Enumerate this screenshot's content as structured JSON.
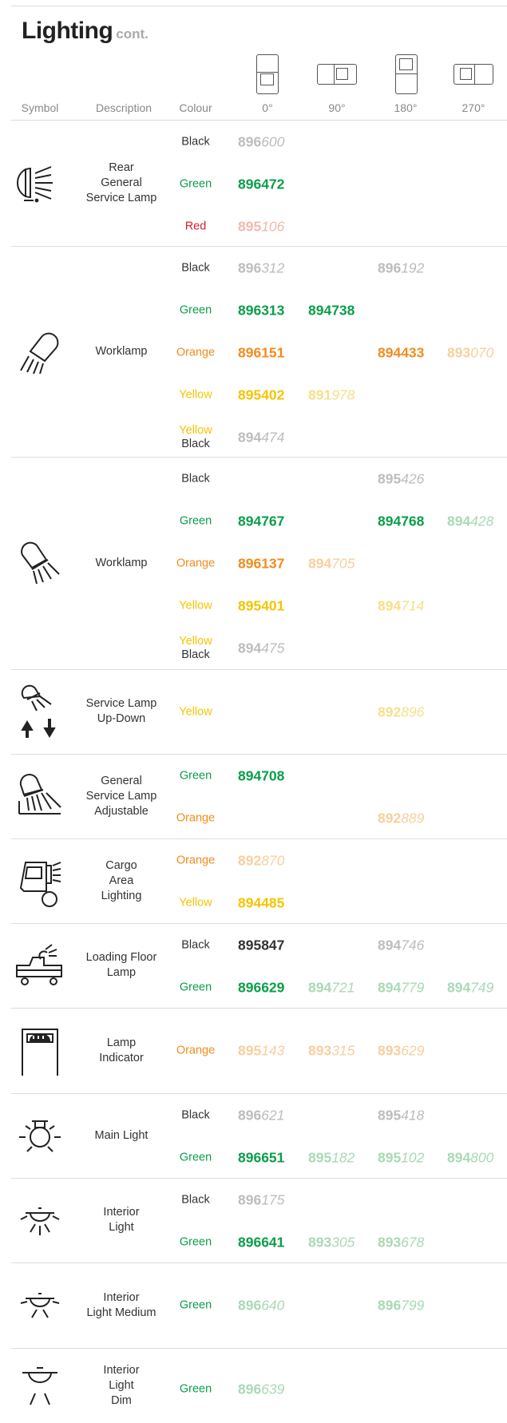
{
  "page": {
    "title": "Lighting",
    "title_suffix": "cont."
  },
  "colors": {
    "Black": "#333333",
    "Green": "#0a9e4a",
    "Red": "#d81e2c",
    "Orange": "#f28c1e",
    "Yellow": "#f5c400",
    "Black_faded": "#bdbdbd",
    "Green_faded": "#a9d9b6",
    "Red_faded": "#f2b9ae",
    "Orange_faded": "#f8cf9e",
    "Yellow_faded": "#f8df8a"
  },
  "headers": {
    "symbol": "Symbol",
    "description": "Description",
    "colour": "Colour",
    "orientations": [
      "0°",
      "90°",
      "180°",
      "270°"
    ]
  },
  "sections": [
    {
      "icon": "rear-general-service-lamp-icon",
      "description": "Rear General Service Lamp",
      "rows": [
        {
          "colour": "Black",
          "parts": [
            {
              "col": 0,
              "prefix": "896",
              "suffix": "600",
              "faded": true
            }
          ]
        },
        {
          "colour": "Green",
          "parts": [
            {
              "col": 0,
              "prefix": "896",
              "suffix": "472",
              "faded": false
            }
          ]
        },
        {
          "colour": "Red",
          "parts": [
            {
              "col": 0,
              "prefix": "895",
              "suffix": "106",
              "faded": true
            }
          ]
        }
      ]
    },
    {
      "icon": "worklamp-icon",
      "description": "Worklamp",
      "rows": [
        {
          "colour": "Black",
          "parts": [
            {
              "col": 0,
              "prefix": "896",
              "suffix": "312",
              "faded": true
            },
            {
              "col": 2,
              "prefix": "896",
              "suffix": "192",
              "faded": true
            }
          ]
        },
        {
          "colour": "Green",
          "parts": [
            {
              "col": 0,
              "prefix": "896",
              "suffix": "313",
              "faded": false
            },
            {
              "col": 1,
              "prefix": "894",
              "suffix": "738",
              "faded": false
            }
          ]
        },
        {
          "colour": "Orange",
          "parts": [
            {
              "col": 0,
              "prefix": "896",
              "suffix": "151",
              "faded": false
            },
            {
              "col": 2,
              "prefix": "894",
              "suffix": "433",
              "faded": false
            },
            {
              "col": 3,
              "prefix": "893",
              "suffix": "070",
              "faded": true
            }
          ]
        },
        {
          "colour": "Yellow",
          "parts": [
            {
              "col": 0,
              "prefix": "895",
              "suffix": "402",
              "faded": false
            },
            {
              "col": 1,
              "prefix": "891",
              "suffix": "978",
              "faded": true
            }
          ]
        },
        {
          "colour": "Yellow Black",
          "parts": [
            {
              "col": 0,
              "prefix": "894",
              "suffix": "474",
              "faded": true
            }
          ]
        }
      ]
    },
    {
      "icon": "worklamp-icon",
      "description": "Worklamp",
      "rows": [
        {
          "colour": "Black",
          "parts": [
            {
              "col": 2,
              "prefix": "895",
              "suffix": "426",
              "faded": true
            }
          ]
        },
        {
          "colour": "Green",
          "parts": [
            {
              "col": 0,
              "prefix": "894",
              "suffix": "767",
              "faded": false
            },
            {
              "col": 2,
              "prefix": "894",
              "suffix": "768",
              "faded": false
            },
            {
              "col": 3,
              "prefix": "894",
              "suffix": "428",
              "faded": true
            }
          ]
        },
        {
          "colour": "Orange",
          "parts": [
            {
              "col": 0,
              "prefix": "896",
              "suffix": "137",
              "faded": false
            },
            {
              "col": 1,
              "prefix": "894",
              "suffix": "705",
              "faded": true
            }
          ]
        },
        {
          "colour": "Yellow",
          "parts": [
            {
              "col": 0,
              "prefix": "895",
              "suffix": "401",
              "faded": false
            },
            {
              "col": 2,
              "prefix": "894",
              "suffix": "714",
              "faded": true
            }
          ]
        },
        {
          "colour": "Yellow Black",
          "parts": [
            {
              "col": 0,
              "prefix": "894",
              "suffix": "475",
              "faded": true
            }
          ]
        }
      ]
    },
    {
      "icon": "service-lamp-up-down-icon",
      "description": "Service Lamp Up-Down",
      "rows": [
        {
          "colour": "Yellow",
          "parts": [
            {
              "col": 2,
              "prefix": "892",
              "suffix": "896",
              "faded": true
            }
          ]
        }
      ]
    },
    {
      "icon": "general-service-lamp-adjustable-icon",
      "description": "General Service Lamp Adjustable",
      "rows": [
        {
          "colour": "Green",
          "parts": [
            {
              "col": 0,
              "prefix": "894",
              "suffix": "708",
              "faded": false
            }
          ]
        },
        {
          "colour": "Orange",
          "parts": [
            {
              "col": 2,
              "prefix": "892",
              "suffix": "889",
              "faded": true
            }
          ]
        }
      ]
    },
    {
      "icon": "cargo-area-lighting-icon",
      "description": "Cargo Area Lighting",
      "rows": [
        {
          "colour": "Orange",
          "parts": [
            {
              "col": 0,
              "prefix": "892",
              "suffix": "870",
              "faded": true
            }
          ]
        },
        {
          "colour": "Yellow",
          "parts": [
            {
              "col": 0,
              "prefix": "894",
              "suffix": "485",
              "faded": false
            }
          ]
        }
      ]
    },
    {
      "icon": "loading-floor-lamp-icon",
      "description": "Loading Floor Lamp",
      "rows": [
        {
          "colour": "Black",
          "parts": [
            {
              "col": 0,
              "prefix": "895",
              "suffix": "847",
              "faded": false
            },
            {
              "col": 2,
              "prefix": "894",
              "suffix": "746",
              "faded": true
            }
          ]
        },
        {
          "colour": "Green",
          "parts": [
            {
              "col": 0,
              "prefix": "896",
              "suffix": "629",
              "faded": false
            },
            {
              "col": 1,
              "prefix": "894",
              "suffix": "721",
              "faded": true
            },
            {
              "col": 2,
              "prefix": "894",
              "suffix": "779",
              "faded": true
            },
            {
              "col": 3,
              "prefix": "894",
              "suffix": "749",
              "faded": true
            }
          ]
        }
      ]
    },
    {
      "icon": "lamp-indicator-icon",
      "description": "Lamp Indicator",
      "rows": [
        {
          "colour": "Orange",
          "parts": [
            {
              "col": 0,
              "prefix": "895",
              "suffix": "143",
              "faded": true
            },
            {
              "col": 1,
              "prefix": "893",
              "suffix": "315",
              "faded": true
            },
            {
              "col": 2,
              "prefix": "893",
              "suffix": "629",
              "faded": true
            }
          ]
        }
      ]
    },
    {
      "icon": "main-light-icon",
      "description": "Main Light",
      "rows": [
        {
          "colour": "Black",
          "parts": [
            {
              "col": 0,
              "prefix": "896",
              "suffix": "621",
              "faded": true
            },
            {
              "col": 2,
              "prefix": "895",
              "suffix": "418",
              "faded": true
            }
          ]
        },
        {
          "colour": "Green",
          "parts": [
            {
              "col": 0,
              "prefix": "896",
              "suffix": "651",
              "faded": false
            },
            {
              "col": 1,
              "prefix": "895",
              "suffix": "182",
              "faded": true
            },
            {
              "col": 2,
              "prefix": "895",
              "suffix": "102",
              "faded": true
            },
            {
              "col": 3,
              "prefix": "894",
              "suffix": "800",
              "faded": true
            }
          ]
        }
      ]
    },
    {
      "icon": "interior-light-icon",
      "description": "Interior Light",
      "rows": [
        {
          "colour": "Black",
          "parts": [
            {
              "col": 0,
              "prefix": "896",
              "suffix": "175",
              "faded": true
            }
          ]
        },
        {
          "colour": "Green",
          "parts": [
            {
              "col": 0,
              "prefix": "896",
              "suffix": "641",
              "faded": false
            },
            {
              "col": 1,
              "prefix": "893",
              "suffix": "305",
              "faded": true
            },
            {
              "col": 2,
              "prefix": "893",
              "suffix": "678",
              "faded": true
            }
          ]
        }
      ]
    },
    {
      "icon": "interior-light-medium-icon",
      "description": "Interior Light Medium",
      "rows": [
        {
          "colour": "Green",
          "parts": [
            {
              "col": 0,
              "prefix": "896",
              "suffix": "640",
              "faded": true
            },
            {
              "col": 2,
              "prefix": "896",
              "suffix": "799",
              "faded": true
            }
          ]
        }
      ]
    },
    {
      "icon": "interior-light-dim-icon",
      "description": "Interior Light Dim",
      "rows": [
        {
          "colour": "Green",
          "parts": [
            {
              "col": 0,
              "prefix": "896",
              "suffix": "639",
              "faded": true
            }
          ]
        }
      ]
    }
  ]
}
